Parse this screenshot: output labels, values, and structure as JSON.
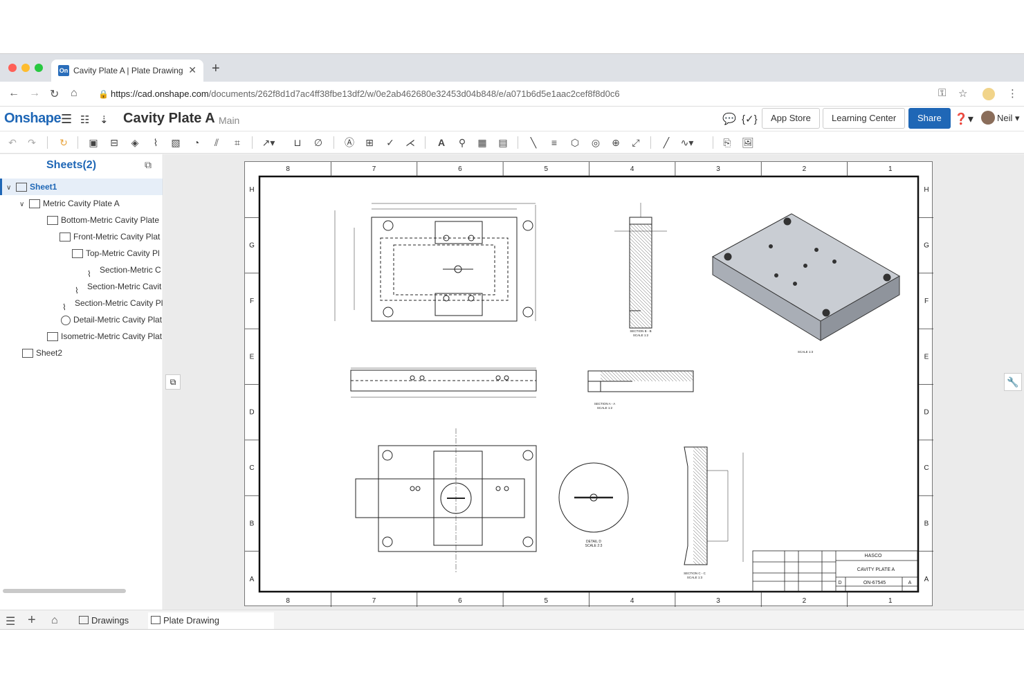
{
  "browser": {
    "tab_title": "Cavity Plate A | Plate Drawing",
    "tab_favicon_text": "On",
    "url_host": "https://cad.onshape.com",
    "url_path": "/documents/262f8d1d7ac4ff38fbe13df2/w/0e2ab462680e32453d04b848/e/a071b6d5e1aac2cef8f8d0c6"
  },
  "app": {
    "logo": "Onshape",
    "document_title": "Cavity Plate A",
    "branch": "Main",
    "app_store_label": "App Store",
    "learning_center_label": "Learning Center",
    "share_label": "Share",
    "user_name": "Neil"
  },
  "sheets": {
    "title": "Sheets(2)",
    "items": [
      {
        "label": "Sheet1"
      },
      {
        "label": "Metric Cavity Plate A"
      },
      {
        "label": "Bottom-Metric Cavity Plate"
      },
      {
        "label": "Front-Metric Cavity Plat"
      },
      {
        "label": "Top-Metric Cavity Pl"
      },
      {
        "label": "Section-Metric C"
      },
      {
        "label": "Section-Metric Cavit"
      },
      {
        "label": "Section-Metric Cavity Pl"
      },
      {
        "label": "Detail-Metric Cavity Plat"
      },
      {
        "label": "Isometric-Metric Cavity Plat"
      },
      {
        "label": "Sheet2"
      }
    ]
  },
  "drawing": {
    "zone_columns": [
      "8",
      "7",
      "6",
      "5",
      "4",
      "3",
      "2",
      "1"
    ],
    "zone_rows": [
      "H",
      "G",
      "F",
      "E",
      "D",
      "C",
      "B",
      "A"
    ],
    "labels": {
      "section_b": "SECTION B - B",
      "section_b_scale": "SCALE 1:2",
      "section_a": "SECTION A - A",
      "section_a_scale": "SCALE 1:2",
      "section_c": "SECTION C - C",
      "section_c_scale": "SCALE 1:3",
      "detail_d": "DETAIL D",
      "detail_d_scale": "SCALE 2:3",
      "iso_scale": "SCALE 1:3"
    },
    "title_block": {
      "company": "HASCO",
      "title": "CAVITY PLATE A",
      "size": "D",
      "dwg_no": "ON-67545",
      "rev": "A"
    }
  },
  "bottom": {
    "drawings_tab": "Drawings",
    "plate_tab": "Plate Drawing"
  }
}
